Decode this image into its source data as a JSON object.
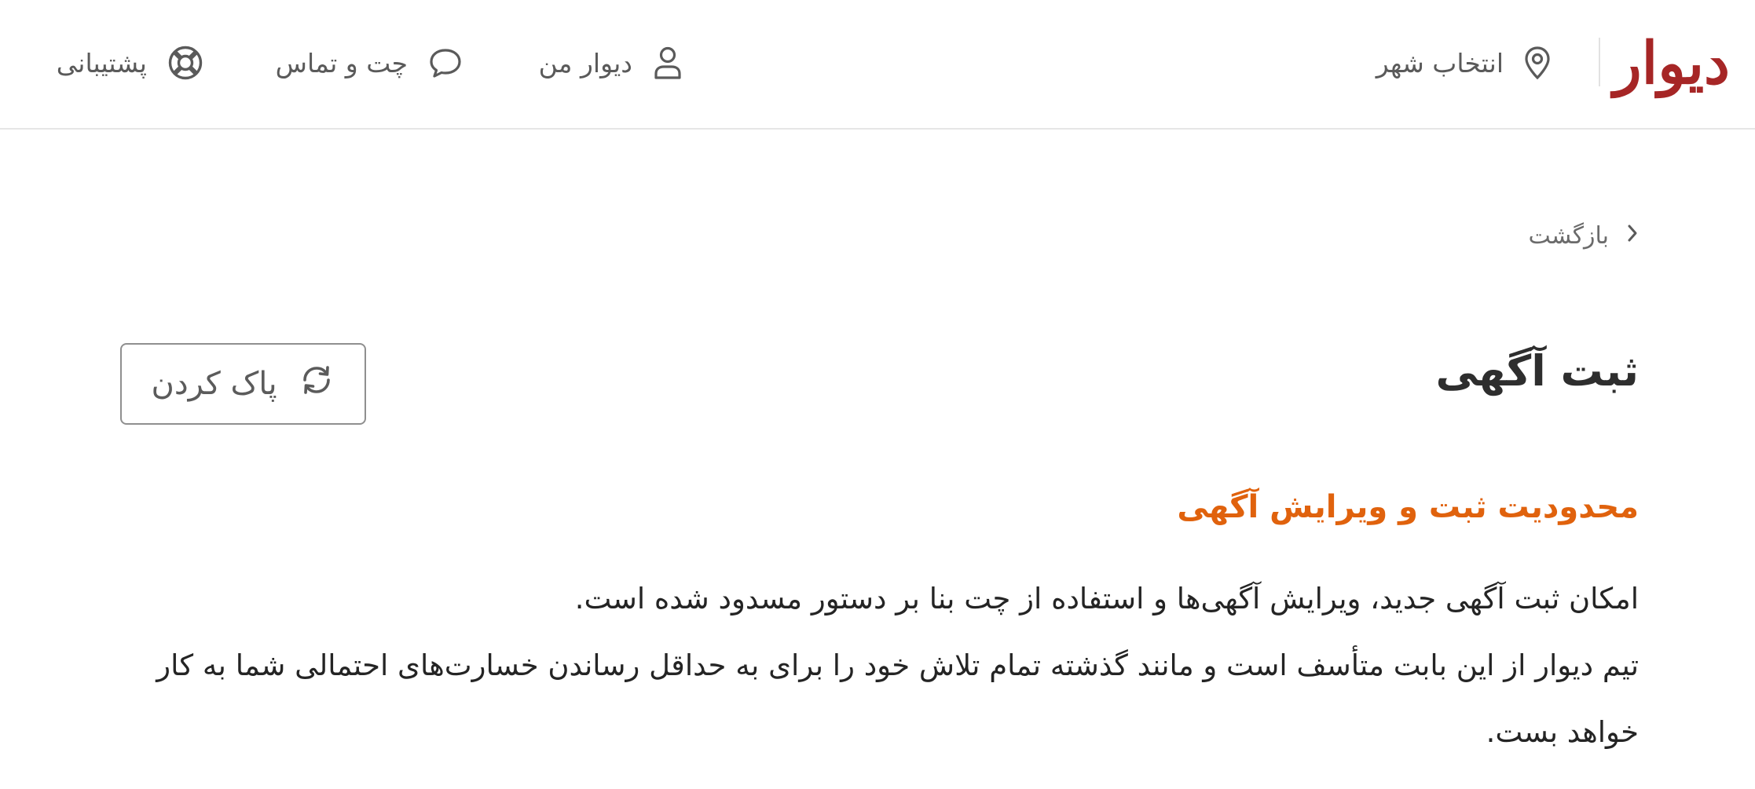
{
  "header": {
    "logo_text": "دیوار",
    "city_label": "انتخاب شهر",
    "my_divar_label": "دیوار من",
    "chat_label": "چت و تماس",
    "support_label": "پشتیبانی",
    "icons": {
      "city": "location-pin-icon",
      "my_divar": "user-icon",
      "chat": "chat-bubble-icon",
      "support": "lifebuoy-icon"
    }
  },
  "main": {
    "back_label": "بازگشت",
    "title": "ثبت آگهی",
    "clear_button_label": "پاک کردن",
    "warning": {
      "title": "محدودیت ثبت و ویرایش آگهی",
      "line1": "امکان ثبت آگهی جدید، ویرایش آگهی‌ها و استفاده از چت بنا بر دستور مسدود شده است.",
      "line2": "تیم دیوار از این بابت متأسف است و مانند گذشته تمام تلاش خود را برای به حداقل رساندن خسارت‌های احتمالی شما به کار خواهد بست."
    }
  },
  "colors": {
    "brand": "#a62626",
    "warning": "#e0620d",
    "text": "#242424",
    "muted": "#5a5a5a",
    "border": "#e6e6e6"
  }
}
